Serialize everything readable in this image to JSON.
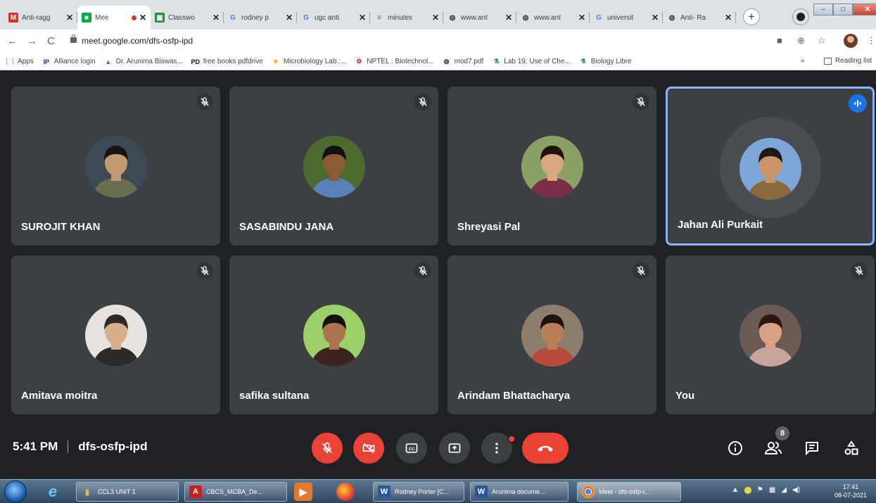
{
  "browser": {
    "tabs": [
      {
        "label": "Anti-ragg",
        "icon": "gmail-icon"
      },
      {
        "label": "Mee",
        "icon": "meet-icon",
        "active": true,
        "recording": true
      },
      {
        "label": "Classwo",
        "icon": "classroom-icon"
      },
      {
        "label": "rodney p",
        "icon": "google-icon"
      },
      {
        "label": "ugc anti",
        "icon": "google-icon"
      },
      {
        "label": "minutes",
        "icon": "doc-icon"
      },
      {
        "label": "www.ant",
        "icon": "globe-icon"
      },
      {
        "label": "www.ant",
        "icon": "globe-icon"
      },
      {
        "label": "universit",
        "icon": "google-icon"
      },
      {
        "label": "Anti- Ra",
        "icon": "globe-icon"
      }
    ],
    "new_tab": "+",
    "url": "meet.google.com/dfs-osfp-ipd",
    "bookmarks": [
      {
        "label": "Apps",
        "icon": "apps-grid-icon"
      },
      {
        "label": "Alliance login",
        "icon": "ip-icon"
      },
      {
        "label": "Dr. Arunima Biswas...",
        "icon": "graduation-cap-icon"
      },
      {
        "label": "free books pdfdrive",
        "icon": "pd-icon"
      },
      {
        "label": "Microbiology Lab :...",
        "icon": "star-icon"
      },
      {
        "label": "NPTEL : Biotechnol...",
        "icon": "nptel-icon"
      },
      {
        "label": "mod7.pdf",
        "icon": "globe-icon"
      },
      {
        "label": "Lab 19: Use of Che...",
        "icon": "flask-icon"
      },
      {
        "label": "Biology Libre",
        "icon": "flask-icon"
      }
    ],
    "bookmarks_more": "»",
    "reading_list": "Reading list"
  },
  "meet": {
    "participants": [
      {
        "name": "SUROJIT KHAN",
        "muted": true,
        "skin": "#c49a72",
        "hair": "#1a1410",
        "shirt": "#6b6e4e",
        "bg": "#3d4a55"
      },
      {
        "name": "SASABINDU JANA",
        "muted": true,
        "skin": "#8a5a34",
        "hair": "#111111",
        "shirt": "#5b7fb8",
        "bg": "#4d6b2f"
      },
      {
        "name": "Shreyasi Pal",
        "muted": true,
        "skin": "#d9a77f",
        "hair": "#20140d",
        "shirt": "#7a2d44",
        "bg": "#8ba067"
      },
      {
        "name": "Jahan Ali Purkait",
        "muted": false,
        "speaking": true,
        "skin": "#c9946a",
        "hair": "#1b1b1b",
        "shirt": "#8a6a3c",
        "bg": "#7ea6d6"
      },
      {
        "name": "Amitava moitra",
        "muted": true,
        "skin": "#d8ae8a",
        "hair": "#2a2a2a",
        "shirt": "#2b2b2e",
        "bg": "#e6e3df"
      },
      {
        "name": "safika sultana",
        "muted": true,
        "skin": "#a8754e",
        "hair": "#151010",
        "shirt": "#3a2320",
        "bg": "#9ccf6a"
      },
      {
        "name": "Arindam Bhattacharya",
        "muted": true,
        "skin": "#b98058",
        "hair": "#1a1512",
        "shirt": "#b84a3a",
        "bg": "#8d7d6c"
      },
      {
        "name": "You",
        "muted": true,
        "skin": "#d7a283",
        "hair": "#2a1612",
        "shirt": "#c7a59a",
        "bg": "#6c5b55"
      }
    ],
    "time": "5:41 PM",
    "meeting_code": "dfs-osfp-ipd",
    "people_count": "8",
    "colors": {
      "accent_red": "#ea4335",
      "speaking_blue": "#1a73e8",
      "tile": "#3c4043"
    }
  },
  "taskbar": {
    "tasks": [
      {
        "label": "CCL3 UNIT 1",
        "icon": "folder-icon"
      },
      {
        "label": "CBCS_MCBA_De...",
        "icon": "pdf-icon"
      },
      {
        "label": "Rodney Porter [C...",
        "icon": "word-icon"
      },
      {
        "label": "Arunima docume...",
        "icon": "word-icon"
      },
      {
        "label": "Meet - dfs-osfp-i...",
        "icon": "chrome-icon"
      }
    ],
    "clock_time": "17:41",
    "clock_date": "08-07-2021"
  }
}
